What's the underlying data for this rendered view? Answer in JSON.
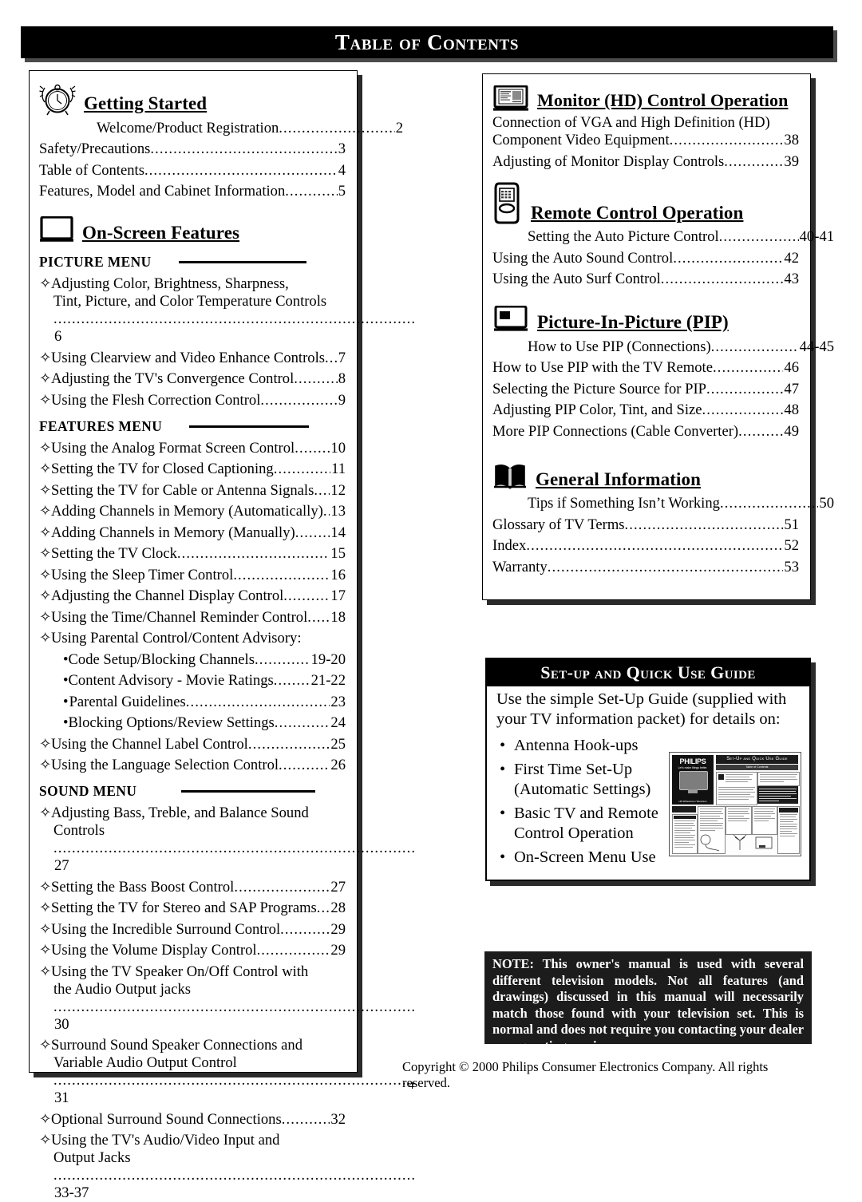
{
  "page": {
    "title": "Table of Contents",
    "copyright": "Copyright © 2000 Philips Consumer Electronics Company. All rights reserved.",
    "page_number": "4"
  },
  "left_column": {
    "sections": [
      {
        "icon": "alarm-clock-icon",
        "heading": "Getting Started",
        "entries": [
          {
            "label": "Welcome/Product Registration",
            "page": "2",
            "indent": "first"
          },
          {
            "label": "Safety/Precautions",
            "page": "3"
          },
          {
            "label": "Table of Contents",
            "page": "4"
          },
          {
            "label": "Features, Model and Cabinet Information",
            "page": "5"
          }
        ]
      },
      {
        "icon": "tv-screen-icon",
        "heading": "On-Screen Features",
        "menus": [
          {
            "label": "PICTURE MENU",
            "entries": [
              {
                "bullet": "diamond",
                "label": "Adjusting Color, Brightness, Sharpness,",
                "cont": "Tint, Picture, and Color Temperature Controls",
                "page": "6"
              },
              {
                "bullet": "diamond",
                "label": "Using Clearview and Video Enhance Controls",
                "page": "7"
              },
              {
                "bullet": "diamond",
                "label": "Adjusting the TV's Convergence Control",
                "page": "8"
              },
              {
                "bullet": "diamond",
                "label": "Using the Flesh Correction Control",
                "page": "9"
              }
            ]
          },
          {
            "label": "FEATURES MENU",
            "entries": [
              {
                "bullet": "diamond",
                "label": "Using the Analog Format Screen Control",
                "page": "10"
              },
              {
                "bullet": "diamond",
                "label": "Setting the TV for Closed Captioning",
                "page": "11"
              },
              {
                "bullet": "diamond",
                "label": "Setting the TV for Cable or Antenna Signals",
                "page": "12"
              },
              {
                "bullet": "diamond",
                "label": "Adding Channels in Memory (Automatically)",
                "page": "13"
              },
              {
                "bullet": "diamond",
                "label": "Adding Channels in Memory (Manually)",
                "page": "14"
              },
              {
                "bullet": "diamond",
                "label": "Setting the TV Clock",
                "page": "15"
              },
              {
                "bullet": "diamond",
                "label": "Using the Sleep Timer Control",
                "page": "16"
              },
              {
                "bullet": "diamond",
                "label": "Adjusting the Channel Display Control",
                "page": "17"
              },
              {
                "bullet": "diamond",
                "label": "Using the Time/Channel Reminder Control",
                "page": "18"
              },
              {
                "bullet": "diamond",
                "label": "Using Parental Control/Content Advisory:",
                "page": ""
              },
              {
                "bullet": "dot",
                "label": "Code Setup/Blocking Channels",
                "page": "19-20"
              },
              {
                "bullet": "dot",
                "label": "Content Advisory - Movie Ratings",
                "page": "21-22"
              },
              {
                "bullet": "dot",
                "label": "Parental Guidelines",
                "page": "23"
              },
              {
                "bullet": "dot",
                "label": "Blocking Options/Review Settings",
                "page": "24"
              },
              {
                "bullet": "diamond",
                "label": "Using the Channel Label Control",
                "page": "25"
              },
              {
                "bullet": "diamond",
                "label": "Using the Language Selection Control",
                "page": "26"
              }
            ]
          },
          {
            "label": "SOUND MENU",
            "entries": [
              {
                "bullet": "diamond",
                "label": "Adjusting Bass, Treble, and Balance Sound",
                "cont": "Controls",
                "page": "27"
              },
              {
                "bullet": "diamond",
                "label": "Setting the Bass Boost Control ",
                "page": "27"
              },
              {
                "bullet": "diamond",
                "label": "Setting the TV for Stereo and SAP Programs",
                "page": "28"
              },
              {
                "bullet": "diamond",
                "label": "Using the Incredible Surround Control",
                "page": "29"
              },
              {
                "bullet": "diamond",
                "label": "Using the Volume Display Control",
                "page": "29"
              },
              {
                "bullet": "diamond",
                "label": "Using the TV Speaker On/Off Control with",
                "cont": "the Audio Output jacks",
                "page": "30"
              },
              {
                "bullet": "diamond",
                "label": "Surround Sound Speaker Connections and",
                "cont": "Variable Audio Output Control",
                "page": "31"
              },
              {
                "bullet": "diamond",
                "label": "Optional Surround Sound Connections",
                "page": "32"
              },
              {
                "bullet": "diamond",
                "label": "Using the TV's Audio/Video Input and",
                "cont": "Output Jacks ",
                "page": "33-37"
              }
            ]
          }
        ]
      }
    ]
  },
  "right_column": {
    "sections": [
      {
        "icon": "monitor-icon",
        "heading": "Monitor (HD) Control Operation",
        "entries": [
          {
            "label": "Connection of VGA and High Definition (HD)",
            "cont_plain": "Component Video Equipment",
            "page": "38"
          },
          {
            "label": "Adjusting of Monitor Display Controls",
            "page": "39"
          }
        ]
      },
      {
        "icon": "remote-control-icon",
        "heading": "Remote Control Operation",
        "entries": [
          {
            "label": "Setting the Auto Picture Control",
            "page": "40-41",
            "indent": "first"
          },
          {
            "label": "Using the Auto Sound Control",
            "page": "42"
          },
          {
            "label": "Using the Auto Surf Control",
            "page": "43"
          }
        ]
      },
      {
        "icon": "pip-icon",
        "heading": "Picture-In-Picture (PIP)",
        "entries": [
          {
            "label": "How to Use PIP (Connections)",
            "page": "44-45",
            "indent": "first"
          },
          {
            "label": "How to Use PIP with the TV Remote",
            "page": "46"
          },
          {
            "label": "Selecting the Picture Source for PIP",
            "page": "47"
          },
          {
            "label": "Adjusting PIP Color, Tint, and Size",
            "page": "48"
          },
          {
            "label": "More PIP Connections (Cable Converter)",
            "page": "49"
          }
        ]
      },
      {
        "icon": "open-book-icon",
        "heading": "General Information",
        "entries": [
          {
            "label": "Tips if Something Isn’t Working",
            "page": "50",
            "indent": "book"
          },
          {
            "label": "Glossary of TV Terms",
            "page": "51"
          },
          {
            "label": "Index",
            "page": "52"
          },
          {
            "label": "Warranty",
            "page": "53"
          }
        ]
      }
    ]
  },
  "setup_guide": {
    "title": "Set-up and Quick Use Guide",
    "intro": "Use the simple Set-Up Guide (supplied with your TV information packet) for details on:",
    "bullets": [
      {
        "text": "Antenna Hook-ups",
        "sub": ""
      },
      {
        "text": "First Time Set-Up",
        "sub": "(Automatic Settings)"
      },
      {
        "text": "Basic TV and Remote",
        "sub": "Control Operation"
      },
      {
        "text": "On-Screen Menu Use",
        "sub": ""
      }
    ],
    "thumbnail": {
      "brand": "PHILIPS",
      "tagline": "Let's make things better.",
      "header": "Set-Up and Quick Use Guide",
      "subheader": "Table of Contents",
      "caption": "HD Widescreen Television"
    }
  },
  "note": {
    "text": "NOTE: This owner's manual is used with several different television models. Not all features (and drawings) discussed in this manual will necessarily match those found with your television set. This is normal and does not require you contacting your dealer or requesting service."
  },
  "bullets": {
    "diamond": "✧",
    "dot": "•"
  },
  "colors": {
    "bar_background": "#000000",
    "bar_text": "#ffffff",
    "note_background": "#1c1c1c",
    "shadow": "#2b2b2b"
  }
}
